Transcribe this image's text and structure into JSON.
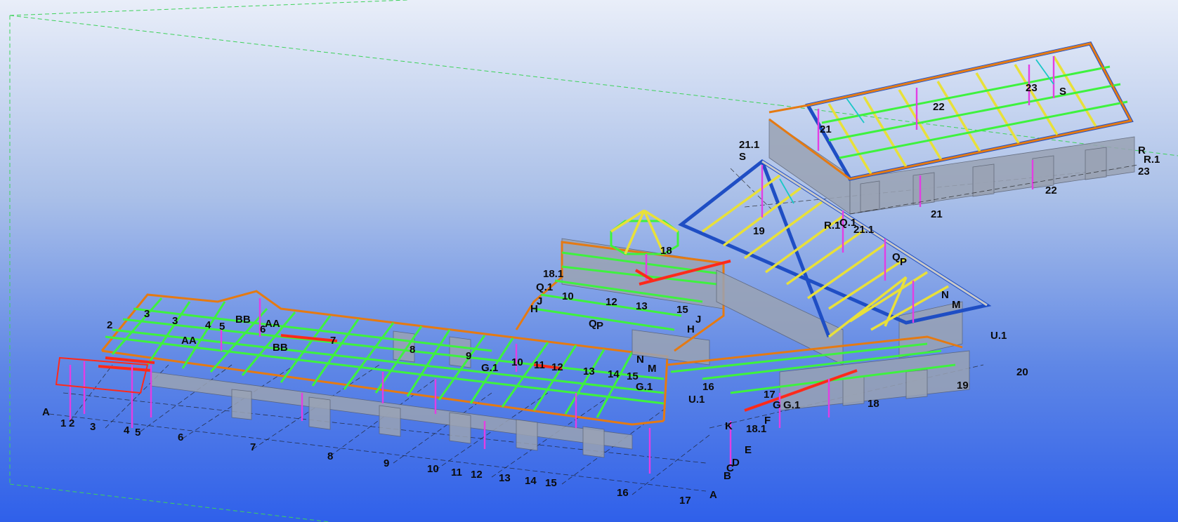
{
  "model": {
    "grid_labels_front": [
      "A",
      "1",
      "2",
      "3",
      "4",
      "5",
      "6",
      "7",
      "8",
      "9",
      "10",
      "11",
      "12",
      "13",
      "14",
      "15",
      "16",
      "17"
    ],
    "grid_labels_left": [
      "A",
      "B",
      "C",
      "D",
      "E",
      "F",
      "G",
      "G.1"
    ],
    "wing_labels": [
      "2",
      "3",
      "4",
      "5",
      "6",
      "7",
      "8",
      "9",
      "10",
      "11",
      "12",
      "13",
      "14",
      "15",
      "16",
      "BB",
      "AA",
      "G.1"
    ],
    "center_labels": [
      "18.1",
      "Q.1",
      "J",
      "H",
      "10",
      "12",
      "13",
      "15",
      "Q",
      "P",
      "N",
      "M",
      "G.1",
      "U.1",
      "K",
      "17",
      "18",
      "19",
      "20",
      "18.1",
      "E",
      "D",
      "B",
      "A",
      "J",
      "H"
    ],
    "tower_label": "18",
    "roof_mid_labels": [
      "19",
      "R.1",
      "Q.1",
      "21.1",
      "Q",
      "P",
      "N",
      "M",
      "U.1"
    ],
    "roof_top_labels": [
      "21.1",
      "S",
      "21",
      "22",
      "23",
      "S",
      "R",
      "R.1",
      "23",
      "22",
      "21"
    ]
  }
}
